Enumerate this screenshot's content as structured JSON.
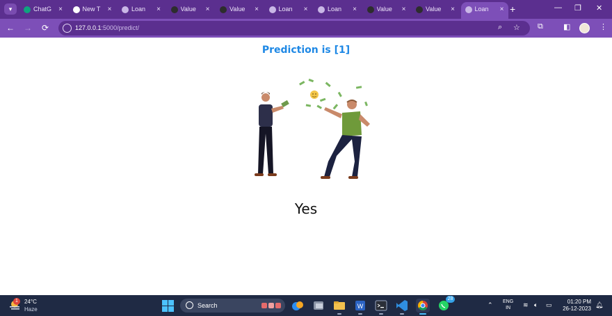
{
  "browser": {
    "tabs": [
      {
        "label": "ChatG",
        "icon": "chatgpt-icon",
        "fav": "#10a37f"
      },
      {
        "label": "New T",
        "icon": "chrome-icon",
        "fav": "#ffffff"
      },
      {
        "label": "Loan",
        "icon": "globe-icon",
        "fav": "#c9b7e6"
      },
      {
        "label": "Value",
        "icon": "terminal-icon",
        "fav": "#2d2d2d"
      },
      {
        "label": "Value",
        "icon": "terminal-icon",
        "fav": "#2d2d2d"
      },
      {
        "label": "Loan",
        "icon": "globe-icon",
        "fav": "#c9b7e6"
      },
      {
        "label": "Loan",
        "icon": "globe-icon",
        "fav": "#c9b7e6"
      },
      {
        "label": "Value",
        "icon": "terminal-icon",
        "fav": "#2d2d2d"
      },
      {
        "label": "Value",
        "icon": "terminal-icon",
        "fav": "#2d2d2d"
      },
      {
        "label": "Loan",
        "icon": "globe-icon",
        "fav": "#c9b7e6",
        "active": true
      }
    ],
    "tab_close_glyph": "×",
    "new_tab_glyph": "+",
    "url_host": "127.0.0.1",
    "url_path": ":5000/predict/"
  },
  "page": {
    "prediction_title": "Prediction is [1]",
    "answer": "Yes",
    "illustration": "celebrating-people-throwing-money-icon"
  },
  "taskbar": {
    "weather_temp": "24°C",
    "weather_desc": "Haze",
    "weather_badge": "1",
    "search_label": "Search",
    "lang_line1": "ENG",
    "lang_line2": "IN",
    "time": "01:20 PM",
    "date": "26-12-2023",
    "whatsapp_badge": "28"
  },
  "colors": {
    "accent_title": "#1e88e5",
    "browser_frame": "#5b2f8f",
    "toolbar": "#7d4fb8",
    "taskbar": "#1f2a44"
  }
}
